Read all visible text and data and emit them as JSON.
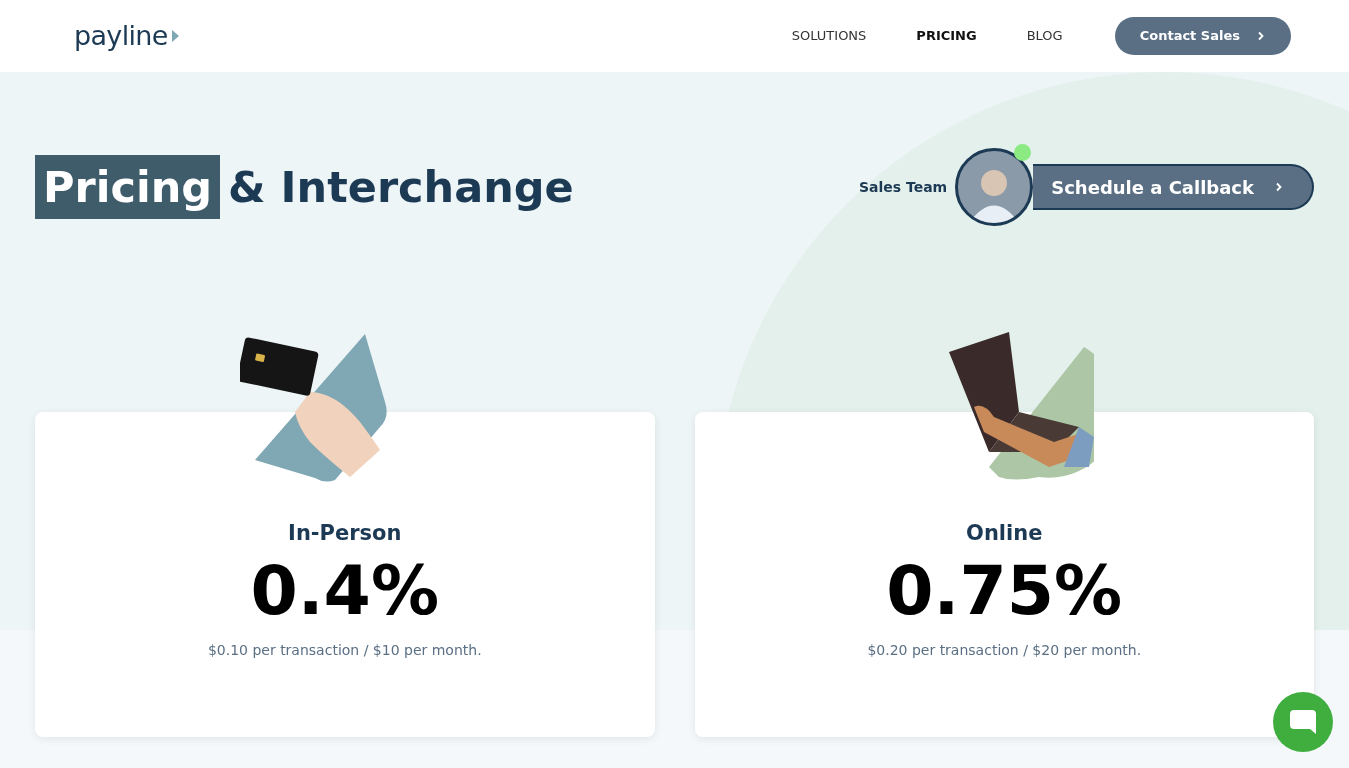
{
  "header": {
    "logo": "payline",
    "nav": [
      {
        "label": "SOLUTIONS",
        "selected": false
      },
      {
        "label": "PRICING",
        "selected": true
      },
      {
        "label": "BLOG",
        "selected": false
      }
    ],
    "cta": "Contact Sales"
  },
  "hero": {
    "title_highlight": "Pricing",
    "title_rest": "& Interchange",
    "sales_label": "Sales Team",
    "callback": "Schedule a Callback",
    "online": true
  },
  "cards": [
    {
      "kind": "card",
      "title": "In-Person",
      "rate": "0.4%",
      "detail": "$0.10 per transaction / $10 per month."
    },
    {
      "kind": "laptop",
      "title": "Online",
      "rate": "0.75%",
      "detail": "$0.20 per transaction / $20 per month."
    }
  ]
}
